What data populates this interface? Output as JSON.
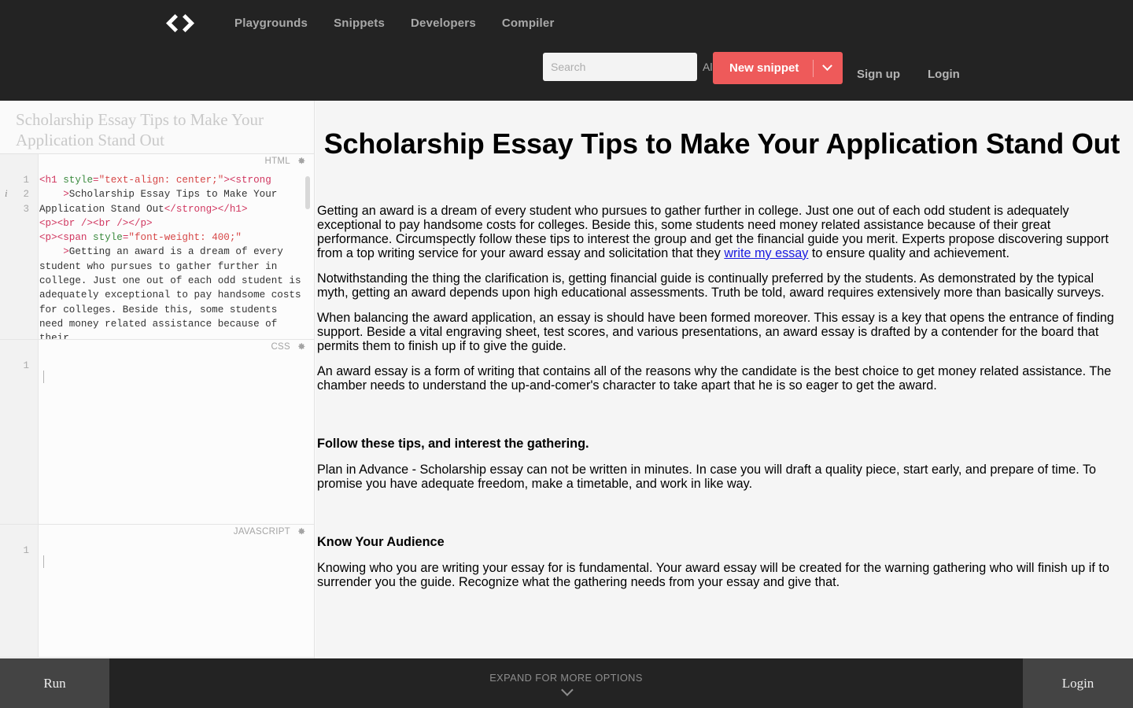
{
  "header": {
    "logo_icon": "code-brackets-logo",
    "nav": [
      {
        "label": "Playgrounds"
      },
      {
        "label": "Snippets"
      },
      {
        "label": "Developers"
      },
      {
        "label": "Compiler"
      }
    ],
    "search": {
      "placeholder": "Search",
      "value": "",
      "scope_label": "All",
      "scope_icon": "chevron-down-icon"
    },
    "new_snippet": {
      "label": "New snippet",
      "caret_icon": "chevron-down-icon",
      "color": "#ee5a5a"
    },
    "auth": {
      "signup_label": "Sign up",
      "login_label": "Login"
    },
    "background": "#232323"
  },
  "editor": {
    "snippet_title": "Scholarship Essay Tips to Make Your Application Stand Out",
    "panes": [
      {
        "label": "HTML",
        "gear_icon": "gear-icon",
        "info_icon": "info-icon",
        "line_numbers": [
          "1",
          "2",
          "3"
        ],
        "code_tokens": [
          {
            "t": "tag",
            "v": "<h1 "
          },
          {
            "t": "attr",
            "v": "style"
          },
          {
            "t": "tag",
            "v": "="
          },
          {
            "t": "str",
            "v": "\"text-align: center;\""
          },
          {
            "t": "tag",
            "v": "><strong"
          },
          {
            "t": "txt",
            "v": "\n    "
          },
          {
            "t": "tag",
            "v": ">"
          },
          {
            "t": "txt",
            "v": "Scholarship Essay Tips to Make Your Application Stand Out"
          },
          {
            "t": "tag",
            "v": "</strong></h1>"
          },
          {
            "t": "txt",
            "v": "\n"
          },
          {
            "t": "tag",
            "v": "<p><br /><br /></p>"
          },
          {
            "t": "txt",
            "v": "\n"
          },
          {
            "t": "tag",
            "v": "<p><span "
          },
          {
            "t": "attr",
            "v": "style"
          },
          {
            "t": "tag",
            "v": "="
          },
          {
            "t": "str",
            "v": "\"font-weight: 400;\""
          },
          {
            "t": "txt",
            "v": "\n    "
          },
          {
            "t": "tag",
            "v": ">"
          },
          {
            "t": "txt",
            "v": "Getting an award is a dream of every student who pursues to gather further in college. Just one out of each odd student is adequately exceptional to pay handsome costs for colleges. Beside this, some students need money related assistance because of their"
          }
        ],
        "has_scrollbar": true
      },
      {
        "label": "CSS",
        "gear_icon": "gear-icon",
        "line_numbers": [
          "1"
        ],
        "code_tokens": [],
        "has_scrollbar": false
      },
      {
        "label": "JAVASCRIPT",
        "gear_icon": "gear-icon",
        "line_numbers": [
          "1"
        ],
        "code_tokens": [],
        "has_scrollbar": false
      }
    ]
  },
  "preview": {
    "heading": "Scholarship Essay Tips to Make Your Application Stand Out",
    "p1_before_link": "Getting an award is a dream of every student who pursues to gather further in college. Just one out of each odd student is adequately exceptional to pay handsome costs for colleges. Beside this, some students need money related assistance because of their great performance. Circumspectly follow these tips to interest the group and get the financial guide you merit. Experts propose discovering support from a top writing service for your award essay and solicitation that they ",
    "p1_link": "write my essay",
    "p1_after_link": " to ensure quality and achievement.",
    "p2": "Notwithstanding the thing the clarification is, getting financial guide is continually preferred by the students. As demonstrated by the typical myth, getting an award depends upon high educational assessments. Truth be told, award requires extensively more than basically surveys.",
    "p3": "When balancing the award application, an essay is should have been formed moreover. This essay is a key that opens the entrance of finding support. Beside a vital engraving sheet, test scores, and various presentations, an award essay is drafted by a contender for the board that permits them to finish up if to give the guide.",
    "p4": "An award essay is a form of writing that contains all of the reasons why the candidate is the best choice to get money related assistance. The chamber needs to understand the up-and-comer's character to take apart that he is so eager to get the award.",
    "h3_1": "Follow these tips, and interest the gathering.",
    "p5": "Plan in Advance - Scholarship essay can not be written in minutes. In case you will draft a quality piece, start early, and prepare of time. To promise you have adequate freedom, make a timetable, and work in like way.",
    "h3_2": "Know Your Audience",
    "p6": "Knowing who you are writing your essay for is fundamental. Your award essay will be created for the warning gathering who will finish up if to surrender you the guide. Recognize what the gathering needs from your essay and give that."
  },
  "bottombar": {
    "run_label": "Run",
    "expand_label": "EXPAND FOR MORE OPTIONS",
    "expand_icon": "chevron-down-icon",
    "login_label": "Login",
    "background": "#444444",
    "center_background": "#232323"
  }
}
